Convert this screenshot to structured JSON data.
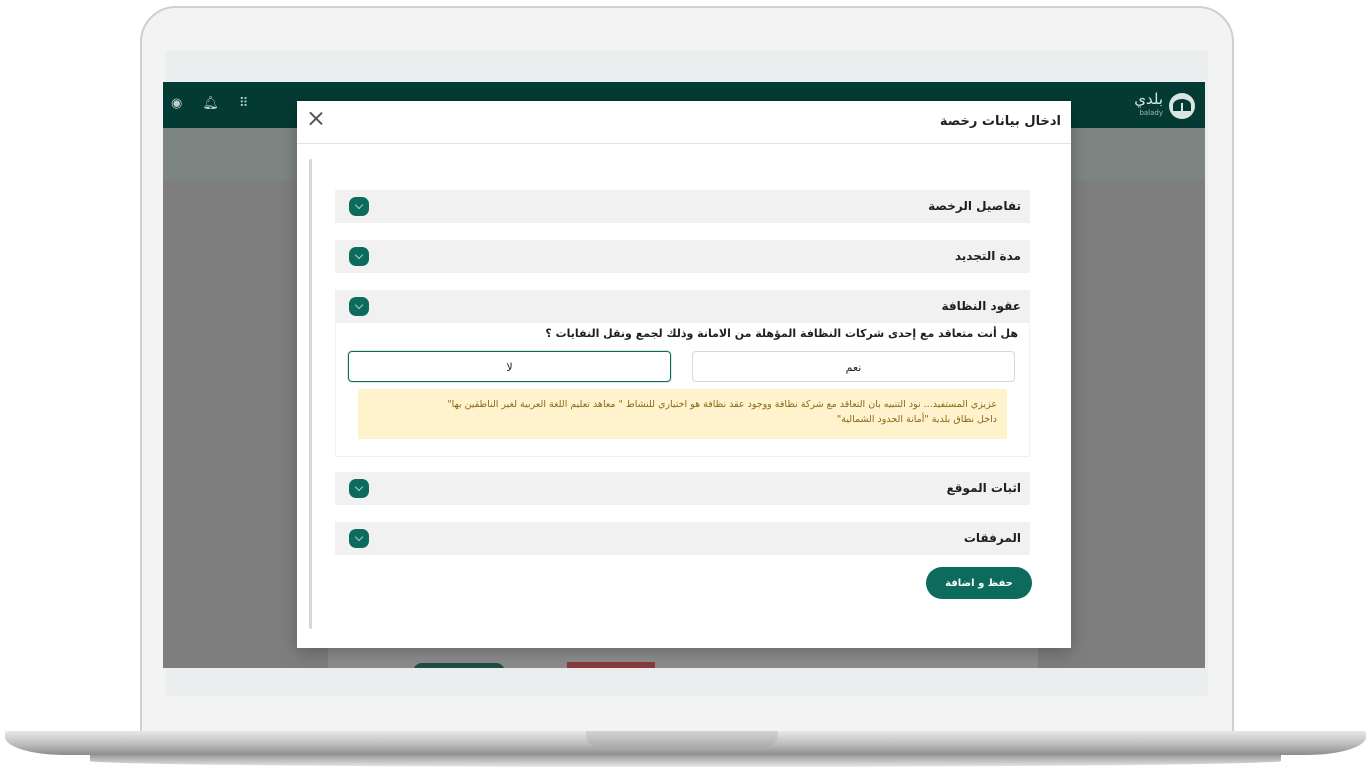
{
  "app": {
    "brand_name": "بلدي",
    "brand_sub": "balady"
  },
  "modal": {
    "title": "ادخال بيانات رخصة",
    "sections": [
      {
        "label": "تفاصيل الرخصة"
      },
      {
        "label": "مدة التجديد"
      },
      {
        "label": "عقود النظافة"
      },
      {
        "label": "اثبات الموقع"
      },
      {
        "label": "المرفقات"
      }
    ],
    "cleaning": {
      "question": "هل أنت متعاقد مع إحدى شركات النظافة المؤهلة من الامانة وذلك لجمع ونقل النفايات ؟",
      "option_yes": "نعم",
      "option_no": "لا",
      "notice_line1": "عزيزي المستفيد... نود التنبيه بان التعاقد مع شركة نظافة ووجود عقد نظافة هو اختياري للنشاط \" معاهد تعليم اللغة العربية لغير الناطقين بها\"",
      "notice_line2": "داخل نطاق بلدية \"أمانة الحدود الشمالية\""
    },
    "save_label": "حفظ و اضافة"
  },
  "icons": {
    "close": "close-icon",
    "chevron": "chevron-down-icon",
    "bell": "bell-icon",
    "grid": "grid-icon",
    "user": "user-icon"
  },
  "colors": {
    "header": "#043a34",
    "accent": "#0d6b5e",
    "notice_bg": "#fff3cd",
    "notice_text": "#8a6a18"
  }
}
